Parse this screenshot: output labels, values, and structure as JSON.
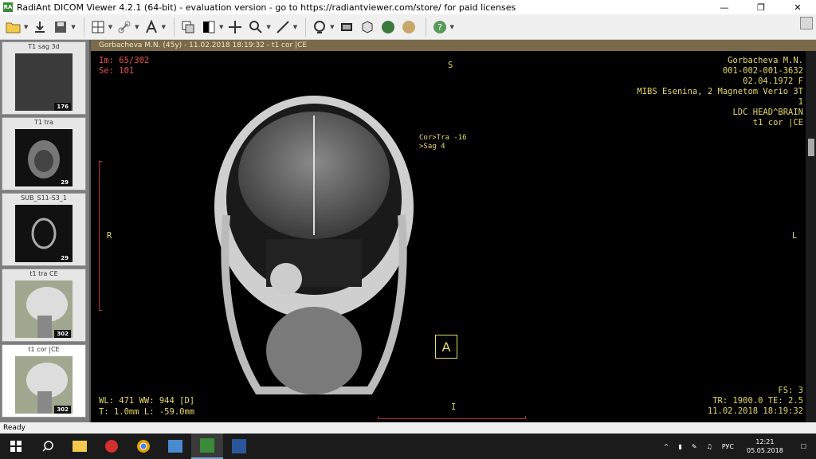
{
  "window": {
    "title": "RadiAnt DICOM Viewer 4.2.1 (64-bit) - evaluation version - go to https://radiantviewer.com/store/ for paid licenses",
    "app_icon": "RA"
  },
  "sidebar": {
    "series": [
      {
        "label": "T1 sag 3d",
        "count": "176"
      },
      {
        "label": "T1 tra",
        "count": "29"
      },
      {
        "label": "SUB_S11-S3_1",
        "count": "29"
      },
      {
        "label": "t1 tra CE",
        "count": "302"
      },
      {
        "label": "t1 cor |CE",
        "count": "302"
      }
    ]
  },
  "viewer": {
    "header": "Gorbacheva M.N. (45y) - 11.02.2018 18:19:32 - t1 cor |CE",
    "top_left": {
      "image": "Im: 65/302",
      "series": "Se: 101"
    },
    "top_right": [
      "Gorbacheva M.N.",
      "001-002-001-3632",
      "02.04.1972 F",
      "MIBS Esenina, 2 Magnetom Verio 3T",
      "1",
      "LDC HEAD^BRAIN",
      "t1 cor |CE"
    ],
    "orient": {
      "top": "S",
      "bottom": "I",
      "left": "R",
      "right": "L"
    },
    "crossref": [
      "Cor>Tra -16",
      ">Sag  4"
    ],
    "orientation_cube": "A",
    "bottom_left": {
      "wl": "WL: 471 WW: 944 [D]",
      "thickness": "T: 1.0mm L: -59.0mm"
    },
    "bottom_right": {
      "fs": "FS: 3",
      "tr": "TR: 1900.0 TE: 2.5",
      "date": "11.02.2018 18:19:32"
    }
  },
  "status": {
    "text": "Ready"
  },
  "taskbar": {
    "time": "12:21",
    "date": "05.05.2018",
    "lang": "РУС"
  },
  "colors": {
    "overlay_red": "#e85050",
    "overlay_yellow": "#e8d868",
    "header_bg": "#7a6a4a"
  }
}
